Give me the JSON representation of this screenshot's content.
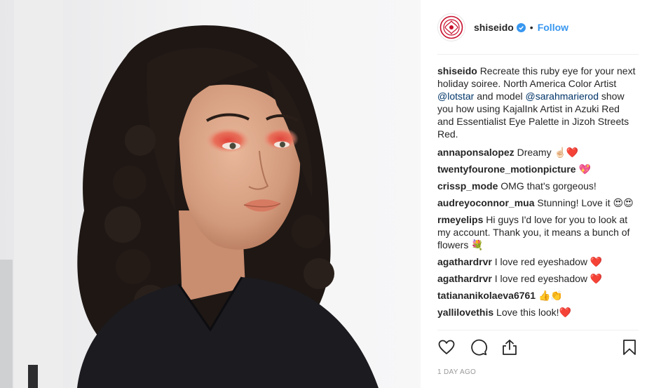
{
  "post": {
    "author": "shiseido",
    "verified": true,
    "separator": "•",
    "follow_label": "Follow",
    "timestamp": "1 DAY AGO"
  },
  "caption": {
    "user": "shiseido",
    "text_1": "Recreate this ruby eye for your next holiday soiree. North America Color Artist ",
    "mention_1": "@lotstar",
    "text_2": " and model ",
    "mention_2": "@sarahmarierod",
    "text_3": " show you how using KajalInk Artist in Azuki Red and Essentialist Eye Palette in Jizoh Streets Red."
  },
  "comments": [
    {
      "user": "annaponsalopez",
      "text": "Dreamy ☝🏻❤️"
    },
    {
      "user": "twentyfourone_motionpicture",
      "text": "💖"
    },
    {
      "user": "crissp_mode",
      "text": "OMG that's gorgeous!"
    },
    {
      "user": "audreyoconnor_mua",
      "text": "Stunning! Love it 😍😍"
    },
    {
      "user": "rmeyelips",
      "text": "Hi guys I'd love for you to look at my account. Thank you, it means a bunch of flowers 💐"
    },
    {
      "user": "agathardrvr",
      "text": "I love red eyeshadow ❤️"
    },
    {
      "user": "agathardrvr",
      "text": "I love red eyeshadow ❤️"
    },
    {
      "user": "tatiananikolaeva6761",
      "text": "👍👏"
    },
    {
      "user": "yallilovethis",
      "text": "Love this look!❤️"
    }
  ],
  "colors": {
    "accent": "#3897f0",
    "brand_red": "#c8102e",
    "verified_blue": "#3897f0",
    "mention": "#003569",
    "muted": "#999999"
  },
  "icons": {
    "avatar": "shiseido-logo",
    "like": "heart-icon",
    "comment": "comment-bubble-icon",
    "share": "share-icon",
    "save": "bookmark-icon"
  }
}
